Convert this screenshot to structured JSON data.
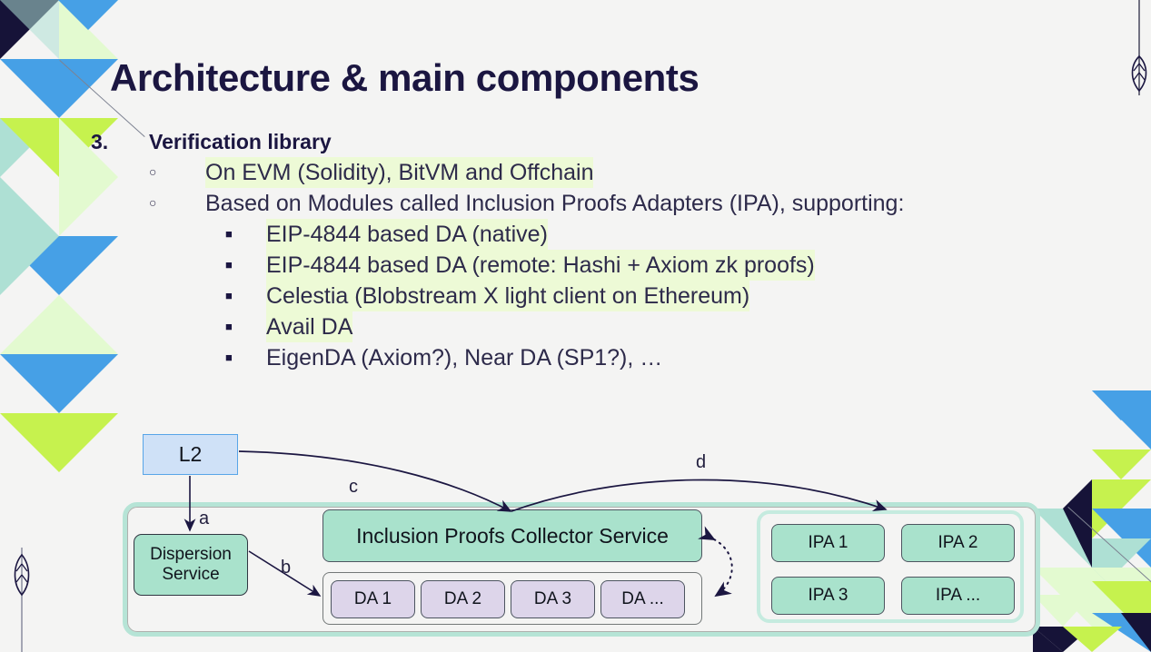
{
  "slide": {
    "title": "Architecture & main components",
    "background_color": "#f4f4f3",
    "title_color": "#1b1641"
  },
  "content": {
    "section_number": "3.",
    "section_title": "Verification library",
    "level2_items": [
      {
        "bullet": "○",
        "text": "On EVM (Solidity), BitVM and Offchain",
        "highlight": true
      },
      {
        "bullet": "○",
        "text": "Based on Modules called Inclusion Proofs Adapters (IPA), supporting:",
        "highlight": false
      }
    ],
    "level3_items": [
      {
        "bullet": "■",
        "text": "EIP-4844 based DA (native)",
        "highlight": true
      },
      {
        "bullet": "■",
        "text": "EIP-4844 based DA (remote: Hashi + Axiom zk proofs)",
        "highlight": true
      },
      {
        "bullet": "■",
        "text": "Celestia (Blobstream X light client on Ethereum)",
        "highlight": true
      },
      {
        "bullet": "■",
        "text": "Avail DA",
        "highlight": true
      },
      {
        "bullet": "■",
        "text": "EigenDA (Axiom?), Near DA (SP1?), …",
        "highlight": false
      }
    ],
    "highlight_color": "#edfad6"
  },
  "diagram": {
    "l2_label": "L2",
    "dispersion_line1": "Dispersion",
    "dispersion_line2": "Service",
    "collector_label": "Inclusion Proofs Collector Service",
    "da_boxes": [
      "DA 1",
      "DA 2",
      "DA 3",
      "DA ..."
    ],
    "ipa_boxes": [
      "IPA 1",
      "IPA 2",
      "IPA 3",
      "IPA ..."
    ],
    "edge_labels": {
      "a": "a",
      "b": "b",
      "c": "c",
      "d": "d"
    },
    "colors": {
      "l2_fill": "#cfe1f7",
      "l2_border": "#58a5e8",
      "service_fill": "#a9e2cc",
      "da_fill": "#ddd5ea",
      "container_border": "#b6e4d6",
      "arrow": "#1b1641"
    }
  },
  "decor": {
    "navy": "#161338",
    "blue": "#46a0e6",
    "lime": "#c6f24e",
    "pale_green": "#e3fad0",
    "mint": "#aee0d4",
    "leaf_icon": "leaf-icon",
    "line_color": "#7d8291"
  }
}
